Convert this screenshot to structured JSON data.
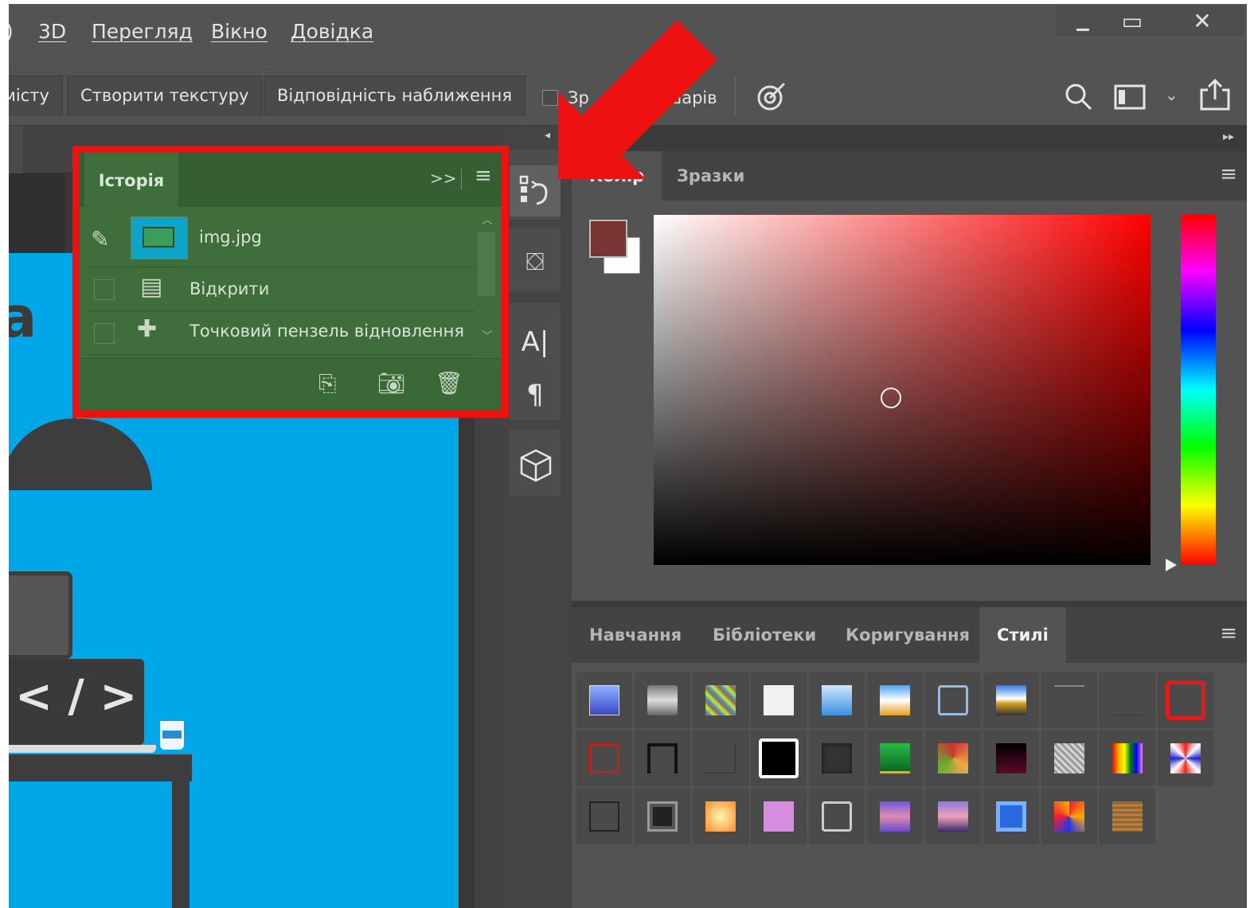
{
  "menu": {
    "items": [
      "3D",
      "Перегляд",
      "Вікно",
      "Довідка"
    ]
  },
  "window_controls": {
    "minimize": "▁",
    "maximize": "▭",
    "close": "✕"
  },
  "toolbar": {
    "btn_partial": "місту",
    "btn_texture": "Створити текстуру",
    "btn_fit": "Відповідність наближення",
    "checkbox_label_a": "Зр",
    "checkbox_label_b": "шарів"
  },
  "history": {
    "tab_label": "Історія",
    "snapshot_name": "img.jpg",
    "items": [
      "Відкрити",
      "Точковий пензель відновлення"
    ],
    "collapse_glyph": ">>"
  },
  "color_panel": {
    "tabs": [
      "Колір",
      "Зразки"
    ],
    "foreground": "#7a3434",
    "background": "#ffffff",
    "hue": "#ff0000"
  },
  "styles_panel": {
    "tabs": [
      "Навчання",
      "Бібліотеки",
      "Коригування",
      "Стилі"
    ]
  },
  "canvas": {
    "code_text": "< / >",
    "letter": "a"
  },
  "colors": {
    "highlight_border": "#ee1111",
    "canvas_blue": "#00a7e8",
    "panel_green": "#3f6e3c"
  }
}
